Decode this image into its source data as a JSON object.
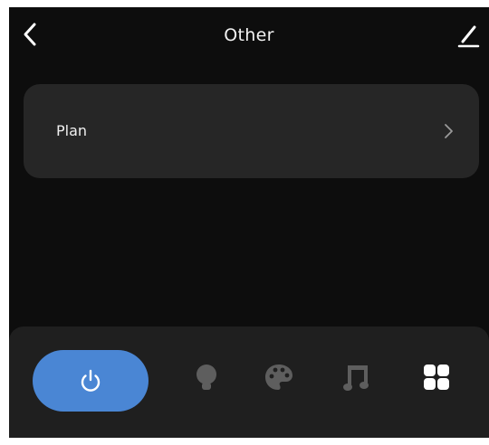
{
  "header": {
    "title": "Other",
    "back_icon": "chevron-left-icon",
    "edit_icon": "pencil-icon"
  },
  "plan": {
    "label": "Plan",
    "chevron_icon": "chevron-right-icon"
  },
  "bottom_bar": {
    "tabs": [
      {
        "name": "power",
        "icon": "power-icon",
        "active": true
      },
      {
        "name": "light",
        "icon": "bulb-icon",
        "active": false
      },
      {
        "name": "color",
        "icon": "palette-icon",
        "active": false
      },
      {
        "name": "music",
        "icon": "music-icon",
        "active": false
      },
      {
        "name": "other",
        "icon": "grid-icon",
        "active": true
      }
    ]
  },
  "colors": {
    "background": "#0d0d0d",
    "card": "#262626",
    "bottom_bar": "#1f1f1f",
    "accent": "#4a86d4",
    "icon_inactive": "#5e5e5e",
    "icon_active": "#ffffff"
  }
}
